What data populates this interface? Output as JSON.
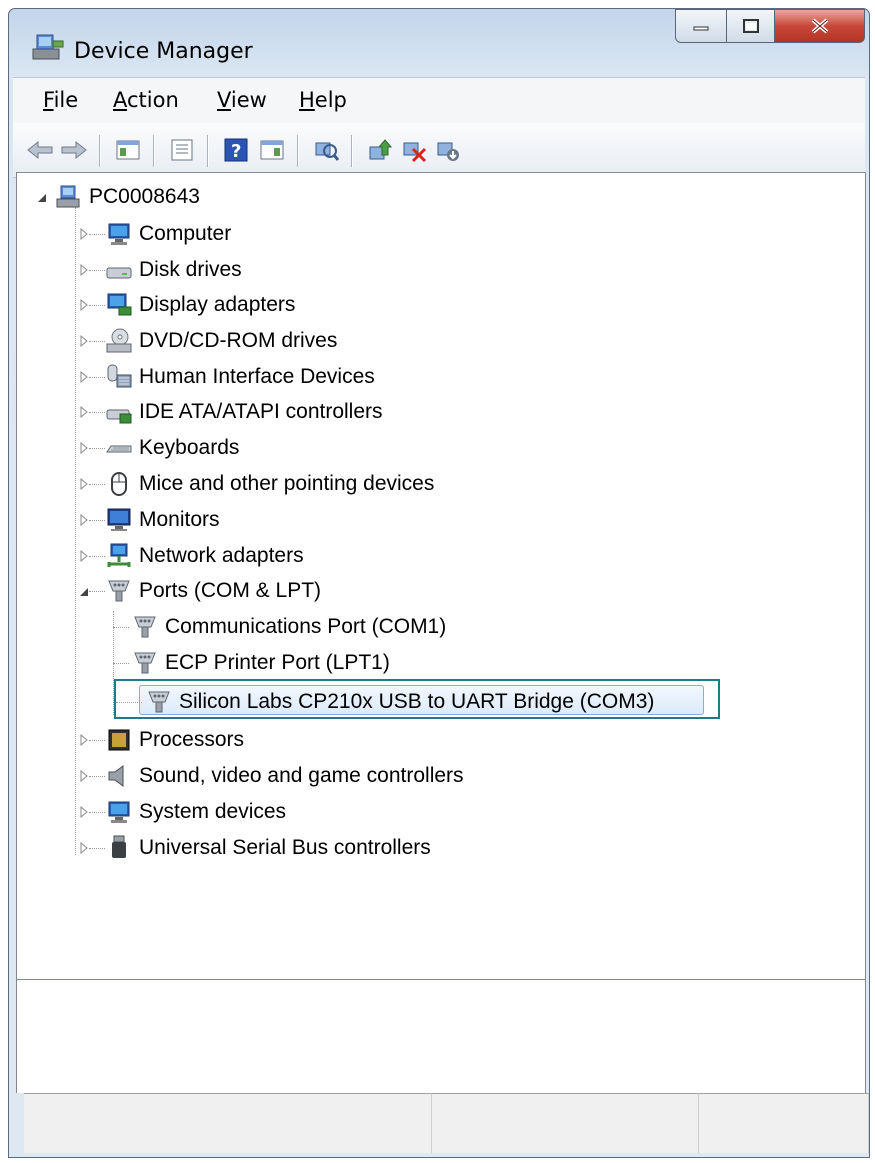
{
  "window": {
    "title": "Device Manager"
  },
  "menu": [
    {
      "label": "File",
      "key": "F",
      "rest": "ile"
    },
    {
      "label": "Action",
      "key": "A",
      "rest": "ction"
    },
    {
      "label": "View",
      "key": "V",
      "rest": "iew"
    },
    {
      "label": "Help",
      "key": "H",
      "rest": "elp"
    }
  ],
  "toolbar": {
    "icons": [
      "back-arrow-icon",
      "forward-arrow-icon",
      "show-hide-console-tree-icon",
      "properties-icon",
      "help-icon",
      "action-pane-icon",
      "scan-hardware-changes-icon",
      "update-driver-icon",
      "uninstall-device-icon",
      "disable-device-icon"
    ]
  },
  "tree": {
    "root": "PC0008643",
    "categories": [
      "Computer",
      "Disk drives",
      "Display adapters",
      "DVD/CD-ROM drives",
      "Human Interface Devices",
      "IDE ATA/ATAPI controllers",
      "Keyboards",
      "Mice and other pointing devices",
      "Monitors",
      "Network adapters",
      "Ports (COM & LPT)",
      "Processors",
      "Sound, video and game controllers",
      "System devices",
      "Universal Serial Bus controllers"
    ],
    "ports_children": [
      "Communications Port (COM1)",
      "ECP Printer Port (LPT1)",
      "Silicon Labs CP210x USB to UART Bridge (COM3)"
    ],
    "selected_item": "Silicon Labs CP210x USB to UART Bridge (COM3)",
    "highlight_color": "#1e7b8a"
  }
}
